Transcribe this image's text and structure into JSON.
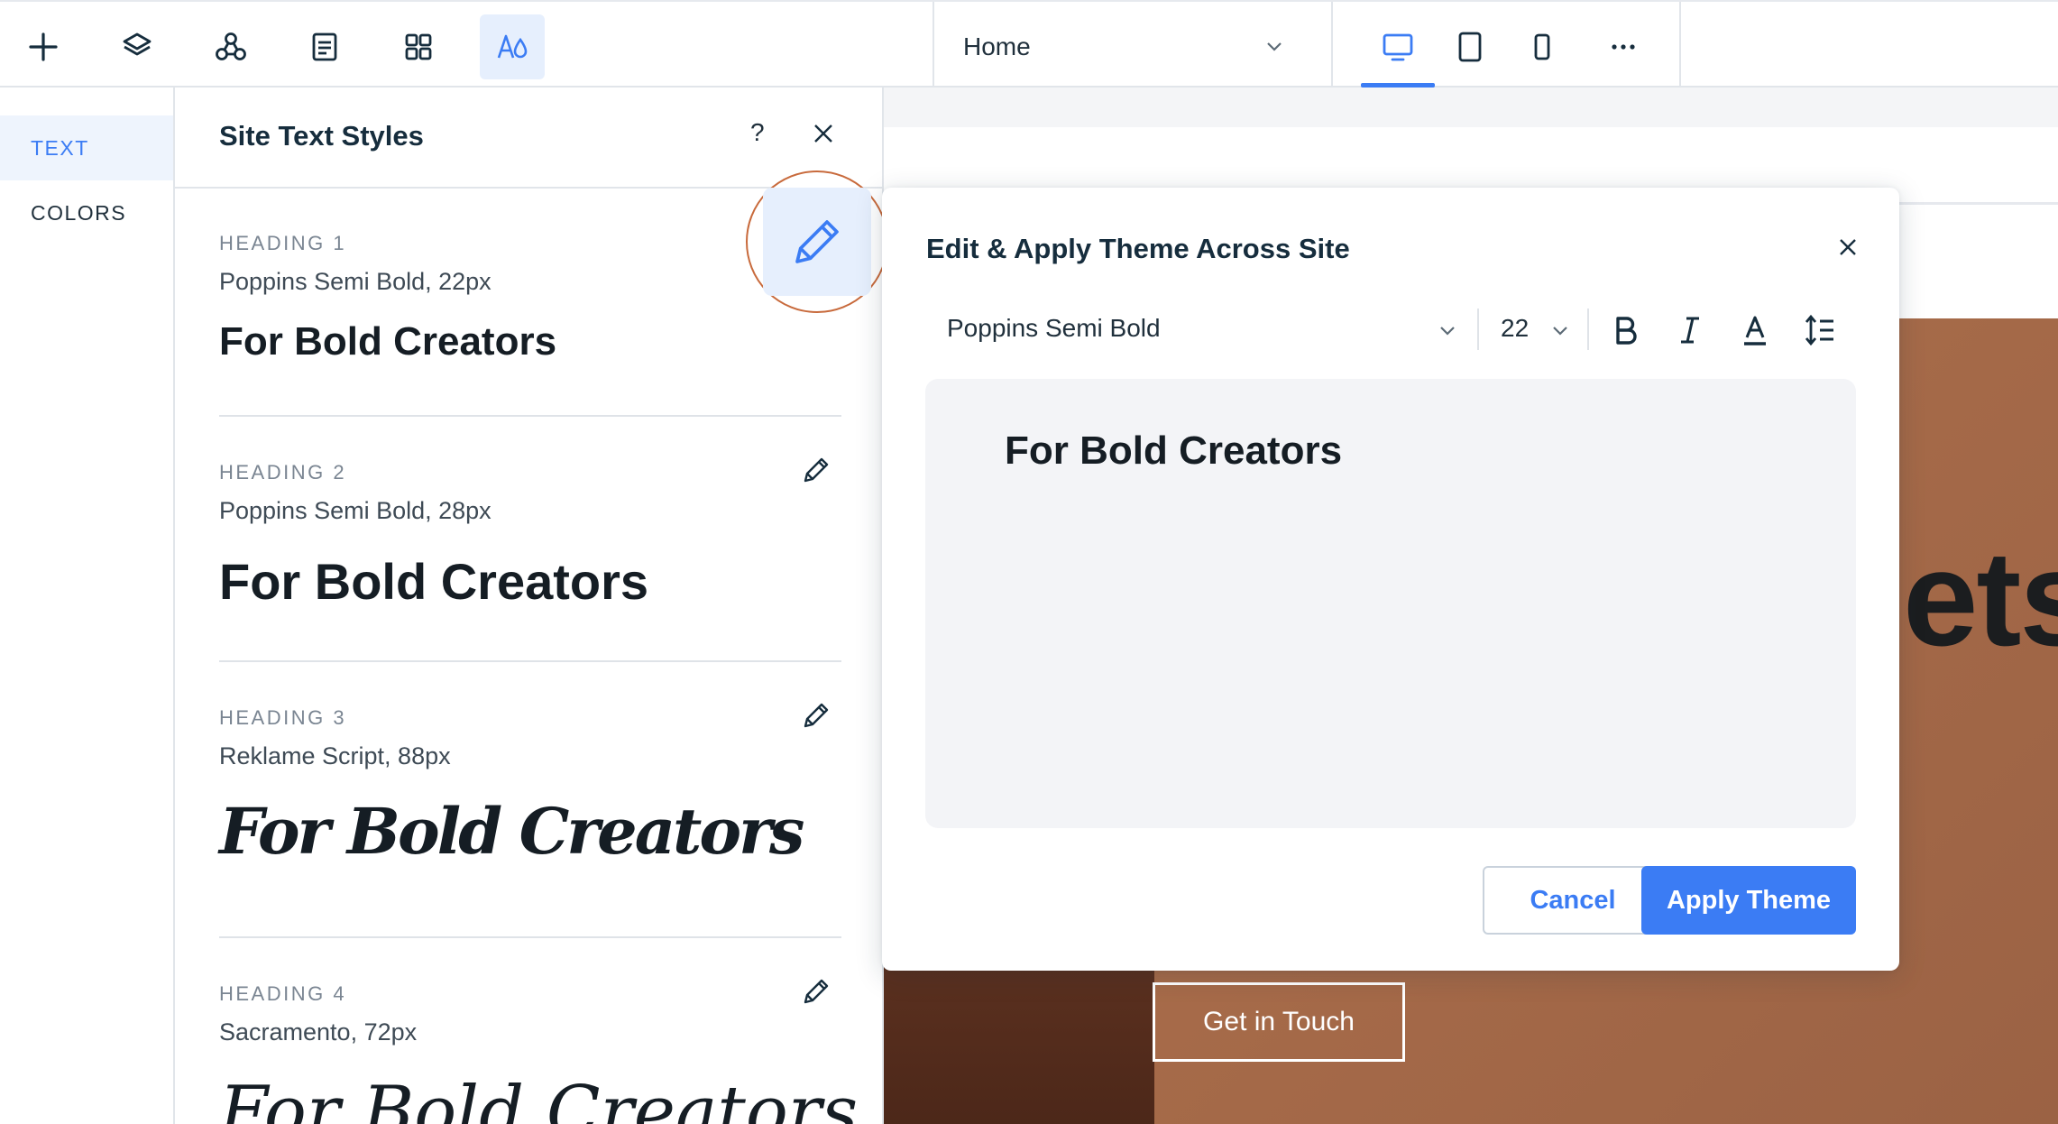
{
  "toolbar": {
    "tools": [
      {
        "icon": "add-icon"
      },
      {
        "icon": "layers-icon"
      },
      {
        "icon": "apps-icon"
      },
      {
        "icon": "pages-icon"
      },
      {
        "icon": "grid-icon"
      },
      {
        "icon": "theme-text-icon",
        "active": true
      }
    ],
    "page_select": {
      "value": "Home",
      "icon": "chevron-down-icon"
    },
    "devices": [
      {
        "icon": "desktop-icon",
        "active": true
      },
      {
        "icon": "tablet-icon"
      },
      {
        "icon": "mobile-icon"
      },
      {
        "icon": "more-icon"
      }
    ]
  },
  "rail": {
    "items": [
      {
        "label": "TEXT",
        "active": true
      },
      {
        "label": "COLORS"
      }
    ]
  },
  "panel": {
    "title": "Site Text Styles",
    "help": "?",
    "styles": [
      {
        "label": "HEADING 1",
        "font": "Poppins Semi Bold, 22px",
        "preview": "For Bold Creators"
      },
      {
        "label": "HEADING 2",
        "font": "Poppins Semi Bold, 28px",
        "preview": "For Bold Creators"
      },
      {
        "label": "HEADING 3",
        "font": "Reklame Script, 88px",
        "preview": "For Bold Creators"
      },
      {
        "label": "HEADING 4",
        "font": "Sacramento, 72px",
        "preview": "For Bold Creators"
      }
    ]
  },
  "modal": {
    "title": "Edit & Apply Theme Across Site",
    "font_family": "Poppins Semi Bold",
    "font_size": "22",
    "format_buttons": [
      "bold-icon",
      "italic-icon",
      "text-color-icon",
      "line-spacing-icon"
    ],
    "preview_text": "For Bold Creators",
    "cancel_label": "Cancel",
    "apply_label": "Apply Theme"
  },
  "canvas": {
    "hero_partial_word": "ets",
    "hero_button": "Get in Touch"
  },
  "colors": {
    "accent": "#3b7cf4",
    "accent_soft": "#e6effd",
    "hover_ring": "#c86a3c",
    "hero_bg": "#a86c4a"
  }
}
